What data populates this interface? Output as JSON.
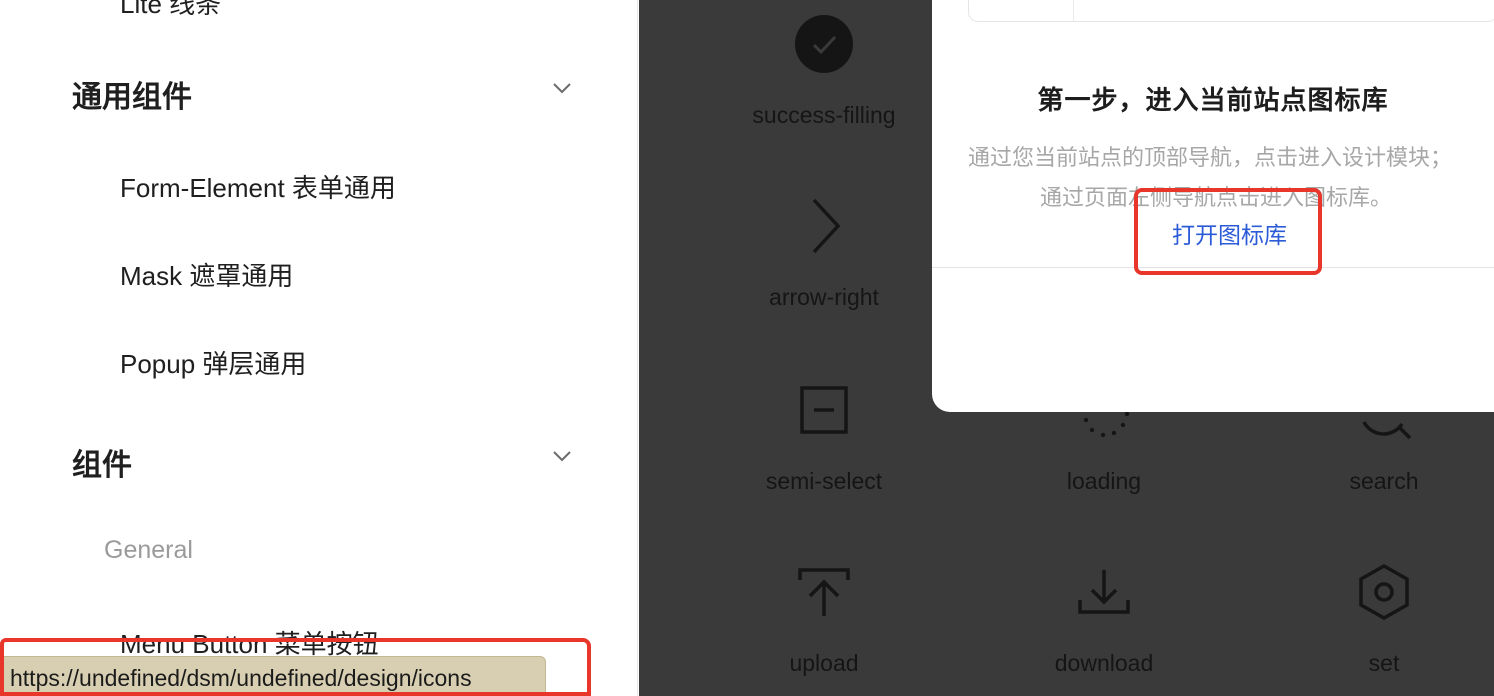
{
  "sidebar": {
    "partial_top_item": "Lite 线条",
    "groups": [
      {
        "label": "通用组件",
        "items": [
          "Form-Element 表单通用",
          "Mask 遮罩通用",
          "Popup 弹层通用"
        ]
      },
      {
        "label": "组件",
        "subgroup": "General",
        "items": [
          "Menu Button 菜单按钮"
        ]
      }
    ]
  },
  "status_url": "https://undefined/dsm/undefined/design/icons",
  "icons": [
    {
      "name": "success-filling",
      "icon": "check-circle-filled-icon"
    },
    {
      "name": "arrow-right",
      "icon": "chevron-right-icon"
    },
    {
      "name": "semi-select",
      "icon": "minus-square-icon"
    },
    {
      "name": "loading",
      "icon": "loading-spinner-icon"
    },
    {
      "name": "search",
      "icon": "search-icon"
    },
    {
      "name": "upload",
      "icon": "upload-icon"
    },
    {
      "name": "download",
      "icon": "download-icon"
    },
    {
      "name": "set",
      "icon": "hexagon-gear-icon"
    }
  ],
  "popup": {
    "title": "第一步，进入当前站点图标库",
    "desc_line1": "通过您当前站点的顶部导航，点击进入设计模块；",
    "desc_line2": "通过页面左侧导航点击进入图标库。",
    "link": "打开图标库"
  },
  "colors": {
    "highlight": "#e8362b",
    "link": "#2c5bd8",
    "overlay": "#3a3a3a"
  }
}
